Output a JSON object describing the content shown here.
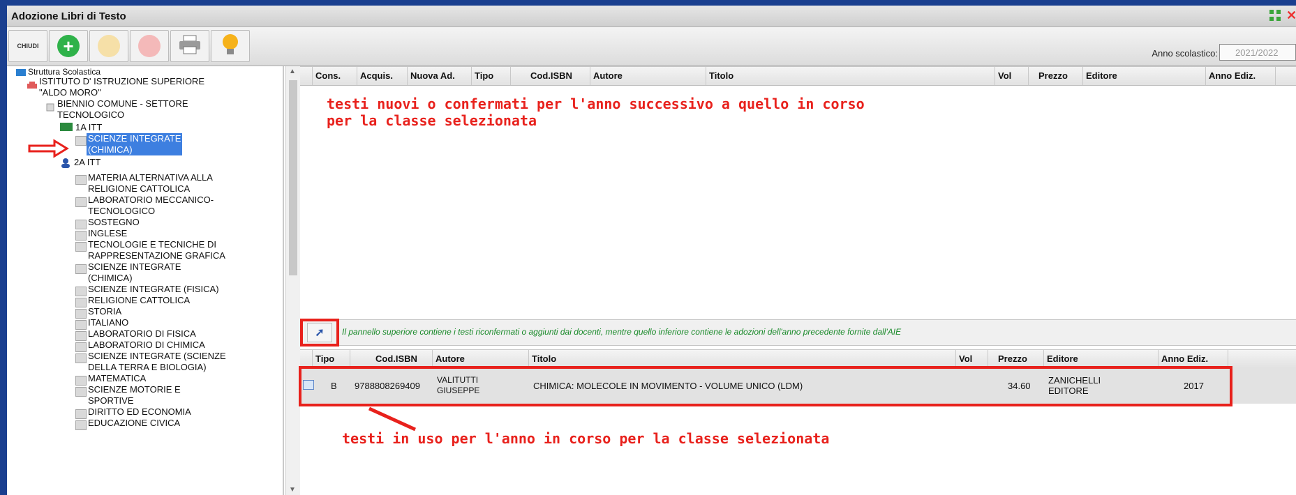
{
  "window": {
    "title": "Adozione Libri di Testo"
  },
  "toolbar": {
    "chiudi_label": "CHIUDI",
    "anno_label": "Anno scolastico:",
    "anno_value": "2021/2022"
  },
  "tree": {
    "root": "Struttura Scolastica",
    "istituto": "ISTITUTO D' ISTRUZIONE SUPERIORE\n\"ALDO MORO\"",
    "biennio": "BIENNIO COMUNE - SETTORE\nTECNOLOGICO",
    "class_1a": "1A ITT",
    "selected_subject": "SCIENZE INTEGRATE\n(CHIMICA)",
    "class_2a": "2A ITT",
    "subjects": [
      "MATERIA ALTERNATIVA ALLA\nRELIGIONE CATTOLICA",
      "LABORATORIO MECCANICO-\nTECNOLOGICO",
      "SOSTEGNO",
      "INGLESE",
      "TECNOLOGIE E TECNICHE DI\nRAPPRESENTAZIONE GRAFICA",
      "SCIENZE INTEGRATE\n(CHIMICA)",
      "SCIENZE INTEGRATE (FISICA)",
      "RELIGIONE CATTOLICA",
      "STORIA",
      "ITALIANO",
      "LABORATORIO DI FISICA",
      "LABORATORIO DI CHIMICA",
      "SCIENZE INTEGRATE (SCIENZE\nDELLA TERRA E BIOLOGIA)",
      "MATEMATICA",
      "SCIENZE MOTORIE E\nSPORTIVE",
      "DIRITTO ED ECONOMIA",
      "EDUCAZIONE CIVICA"
    ]
  },
  "upper_grid": {
    "columns": [
      "Cons.",
      "Acquis.",
      "Nuova Ad.",
      "Tipo",
      "Cod.ISBN",
      "Autore",
      "Titolo",
      "Vol",
      "Prezzo",
      "Editore",
      "Anno Ediz."
    ]
  },
  "annotations": {
    "upper": "testi nuovi o confermati per l'anno successivo a quello in corso\nper la classe selezionata",
    "lower": "testi in uso per l'anno in corso per la classe selezionata"
  },
  "info_bar": {
    "text": "Il pannello superiore contiene i testi riconfermati o aggiunti dai docenti, mentre quello inferiore contiene le adozioni dell'anno precedente fornite dall'AIE"
  },
  "lower_grid": {
    "columns": [
      "Tipo",
      "Cod.ISBN",
      "Autore",
      "Titolo",
      "Vol",
      "Prezzo",
      "Editore",
      "Anno Ediz."
    ],
    "rows": [
      {
        "tipo": "B",
        "isbn": "9788808269409",
        "autore": "VALITUTTI\nGIUSEPPE",
        "titolo": "CHIMICA: MOLECOLE IN MOVIMENTO - VOLUME UNICO (LDM)",
        "vol": "",
        "prezzo": "34.60",
        "editore": "ZANICHELLI\nEDITORE",
        "anno": "2017"
      }
    ]
  },
  "colors": {
    "accent_red": "#e8211c",
    "selection_blue": "#3d7fe0",
    "info_green": "#1a8a2a",
    "frame_blue": "#1a3f8f"
  }
}
